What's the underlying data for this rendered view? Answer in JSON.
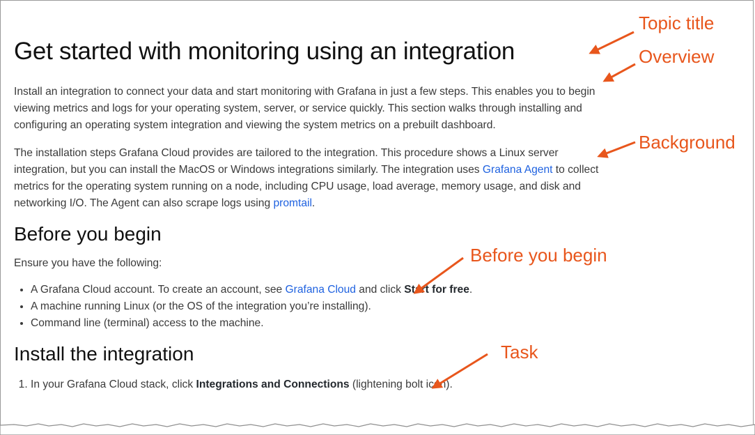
{
  "doc": {
    "title": "Get started with monitoring using an integration",
    "intro": "Install an integration to connect your data and start monitoring with Grafana in just a few steps. This enables you to begin viewing metrics and logs for your operating system, server, or service quickly. This section walks through installing and configuring an operating system integration and viewing the system metrics on a prebuilt dashboard.",
    "bg_part1": "The installation steps Grafana Cloud provides are tailored to the integration. This procedure shows a Linux server integration, but you can install the MacOS or Windows integrations similarly. The integration uses ",
    "bg_link1": "Grafana Agent",
    "bg_part2": " to collect metrics for the operating system running on a node, including CPU usage, load average, memory usage, and disk and networking I/O. The Agent can also scrape logs using ",
    "bg_link2": "promtail",
    "bg_part3": ".",
    "before_heading": "Before you begin",
    "before_intro": "Ensure you have the following:",
    "req1_part1": "A Grafana Cloud account. To create an account, see ",
    "req1_link": "Grafana Cloud",
    "req1_part2": " and click ",
    "req1_bold": "Start for free",
    "req1_part3": ".",
    "req2": "A machine running Linux (or the OS of the integration you’re installing).",
    "req3": "Command line (terminal) access to the machine.",
    "install_heading": "Install the integration",
    "step1_part1": "In your Grafana Cloud stack, click ",
    "step1_bold": "Integrations and Connections",
    "step1_part2": " (lightening bolt icon)."
  },
  "annotations": {
    "topic_title": "Topic title",
    "overview": "Overview",
    "background": "Background",
    "before_you_begin": "Before you begin",
    "task": "Task"
  },
  "colors": {
    "annotation": "#e8561c",
    "link": "#1f62e0"
  }
}
